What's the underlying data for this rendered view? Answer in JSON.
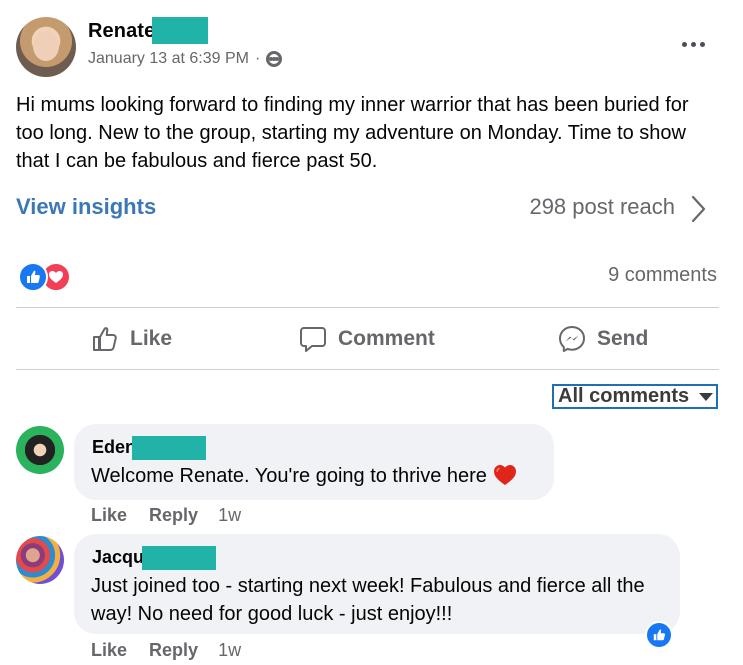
{
  "post": {
    "author": "Renate",
    "timestamp": "January 13 at 6:39 PM",
    "separator": "·",
    "privacy_icon": "group-icon",
    "text": "Hi mums looking forward to finding my inner warrior that has been buried for too long.  New to the group, starting my adventure on Monday.  Time to show that I can be fabulous and fierce past 50.",
    "more_icon": "more-options-icon"
  },
  "insights": {
    "view_label": "View insights",
    "reach_label": "298 post reach"
  },
  "engagement": {
    "reactions": [
      "like",
      "love"
    ],
    "comments_label": "9 comments"
  },
  "actions": {
    "like": "Like",
    "comment": "Comment",
    "send": "Send"
  },
  "filter": {
    "label": "All comments"
  },
  "comments": [
    {
      "author": "Eden",
      "text": "Welcome Renate. You're going to thrive here",
      "emoji": "heart",
      "like_label": "Like",
      "reply_label": "Reply",
      "time": "1w"
    },
    {
      "author": "Jacqui",
      "text": "Just joined too - starting next week! Fabulous and fierce all the way! No need for good luck - just enjoy!!!",
      "like_label": "Like",
      "reply_label": "Reply",
      "time": "1w",
      "reaction": "like"
    }
  ],
  "colors": {
    "link": "#3b78b5",
    "meta": "#65676b",
    "redact": "#22b3a8",
    "bubble": "#f0f2f5",
    "like": "#1877f2",
    "love": "#f33e58",
    "focus_outline": "#1f6fb2"
  }
}
